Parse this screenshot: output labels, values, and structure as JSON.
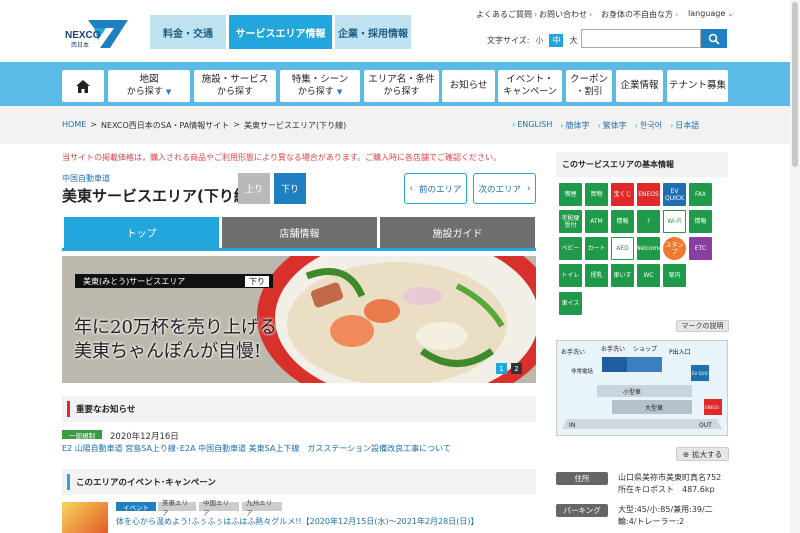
{
  "header": {
    "logo_text": "NEXCO",
    "logo_sub": "西日本",
    "tabs": [
      {
        "label": "料金・交通"
      },
      {
        "label": "サービスエリア情報"
      },
      {
        "label": "企業・採用情報"
      }
    ],
    "util_links": [
      {
        "label": "よくあるご質問"
      },
      {
        "label": "お問い合わせ"
      },
      {
        "label": "お身体の不自由な方"
      },
      {
        "label": "language"
      }
    ],
    "font_size_label": "文字サイズ:",
    "font_sizes": [
      "小",
      "中",
      "大"
    ],
    "search_placeholder": ""
  },
  "nav": {
    "items": [
      {
        "label": "地図",
        "sub": "から探す"
      },
      {
        "label": "施設・サービス",
        "sub": "から探す"
      },
      {
        "label": "特集・シーン",
        "sub": "から探す"
      },
      {
        "label": "エリア名・条件",
        "sub": "から探す"
      },
      {
        "label": "お知らせ",
        "sub": ""
      },
      {
        "label": "イベント・",
        "sub": "キャンペーン"
      },
      {
        "label": "クーポン",
        "sub": "・割引"
      },
      {
        "label": "企業情報",
        "sub": ""
      },
      {
        "label": "テナント募集",
        "sub": ""
      }
    ]
  },
  "breadcrumb": {
    "home": "HOME",
    "site": "NEXCO西日本のSA・PA情報サイト",
    "current": "美東サービスエリア(下り線)",
    "sep": ">"
  },
  "languages": [
    "ENGLISH",
    "簡体字",
    "繁体字",
    "한국어",
    "日本語"
  ],
  "notice": "当サイトの掲載価格は，購入される商品やご利用形態により異なる場合があります。ご購入時に各店舗でご確認ください。",
  "area": {
    "route": "中国自動車道",
    "title": "美東サービスエリア(下り線)",
    "dir_up": "上り",
    "dir_down": "下り",
    "prev": "前のエリア",
    "next": "次のエリア"
  },
  "content_tabs": [
    "トップ",
    "店舗情報",
    "施設ガイド"
  ],
  "hero": {
    "label": "美東(みとう)サービスエリア",
    "label_dir": "下り",
    "line1": "年に20万杯を売り上げる",
    "line2": "美東ちゃんぽんが自慢!",
    "pages": [
      "1",
      "2"
    ]
  },
  "news": {
    "heading": "重要なお知らせ",
    "badge": "一部規制",
    "date": "2020年12月16日",
    "link": "E2 山陽自動車道 宮島SA上り線･E2A 中国自動車道 美東SA上下線　ガスステーション設備改良工事について"
  },
  "events": {
    "heading": "このエリアのイベント･キャンペーン",
    "tags": [
      "イベント",
      "美東エリア",
      "中国エリア",
      "九州エリア"
    ],
    "link": "体を心から温めよう!ふぅふぅはふはふ熱々グルメ!!【2020年12月15日(水)～2021年2月28日(日)】"
  },
  "sidebar": {
    "heading": "このサービスエリアの基本情報",
    "icons": [
      {
        "name": "smoking",
        "text": "喫煙"
      },
      {
        "name": "shopping",
        "text": "買物"
      },
      {
        "name": "lottery",
        "text": "宝くじ",
        "style": "r"
      },
      {
        "name": "eneos",
        "text": "ENEOS",
        "style": "r"
      },
      {
        "name": "ev-quick",
        "text": "EV QUICK",
        "style": "b"
      },
      {
        "name": "fax",
        "text": "FAX"
      },
      {
        "name": "delivery",
        "text": "宅配便受付"
      },
      {
        "name": "atm",
        "text": "ATM"
      },
      {
        "name": "highway-info",
        "text": "情報"
      },
      {
        "name": "help",
        "text": "?"
      },
      {
        "name": "wifi",
        "text": "Wi-Fi",
        "style": "w"
      },
      {
        "name": "wheelchair-info",
        "text": "情報"
      },
      {
        "name": "baby",
        "text": "ベビー"
      },
      {
        "name": "cart",
        "text": "カート"
      },
      {
        "name": "aed",
        "text": "AED",
        "style": "w"
      },
      {
        "name": "welcome",
        "text": "Welcome"
      },
      {
        "name": "stamp",
        "text": "スタンプ",
        "style": "o"
      },
      {
        "name": "etc",
        "text": "ETC",
        "style": "p"
      },
      {
        "name": "restroom",
        "text": "トイレ"
      },
      {
        "name": "nursing",
        "text": "授乳"
      },
      {
        "name": "accessible",
        "text": "車いす"
      },
      {
        "name": "wc",
        "text": "WC"
      },
      {
        "name": "info-person",
        "text": "案内"
      },
      {
        "name": "wheelchair",
        "text": "車イス"
      }
    ],
    "legend_label": "マークの説明",
    "map_labels": {
      "toilet1": "お手洗い",
      "toilet2": "お手洗い",
      "shop": "ショップ",
      "entrance": "P出入口",
      "phone": "非常電話",
      "small": "小型車",
      "large": "大型車",
      "in": "IN",
      "out": "OUT",
      "evquick": "EV QUICK",
      "eneos": "ENEOS"
    },
    "zoom_label": "拡大する",
    "address_key": "住所",
    "address_value": "山口県美祢市美東町真名752",
    "kp_value": "所在キロポスト　487.6kp",
    "parking_key": "パーキング",
    "parking_value": "大型:45/小:85/兼用:39/二輪:4/トレーラー:2"
  }
}
